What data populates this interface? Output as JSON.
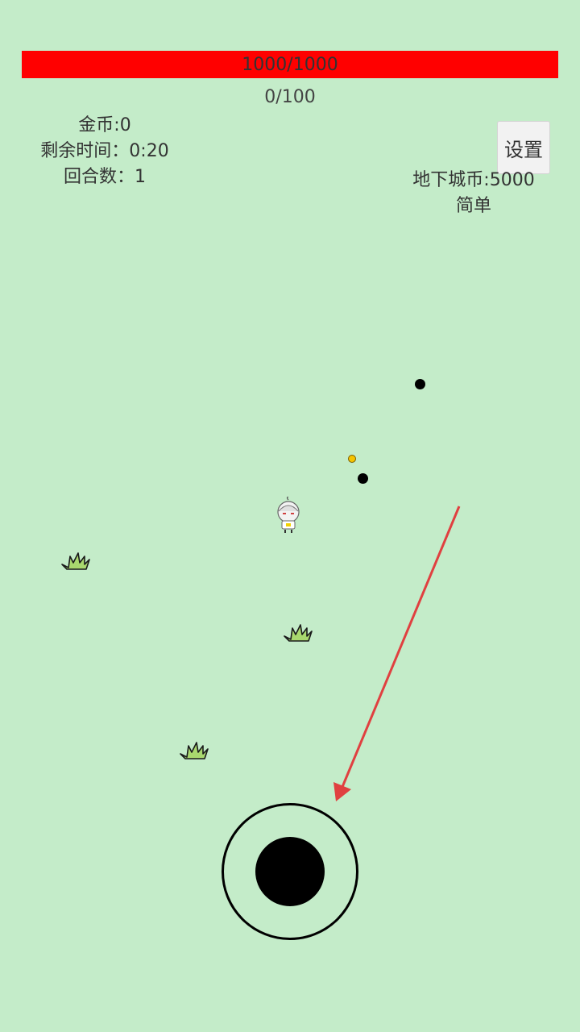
{
  "colors": {
    "background": "#c4ecc9",
    "hp_bar": "#ff0000",
    "enemy": "#000000",
    "coin": "#f5c400",
    "arrow": "#e04040",
    "grass_fill": "#a9d86e",
    "grass_outline": "#1a1a1a",
    "joystick": "#000000"
  },
  "hud": {
    "hp_text": "1000/1000",
    "hp_fraction": 1.0,
    "xp_text": "0/100",
    "gold": "金币:0",
    "time_left": "剩余时间：0:20",
    "round": "回合数：1",
    "settings_label": "设置",
    "dungeon_coins": "地下城币:5000",
    "difficulty": "简单"
  },
  "icons": {
    "player": "chibi-character-icon",
    "enemy": "black-dot-enemy",
    "coin": "gold-coin-icon",
    "grass": "grass-tuft-icon",
    "arrow": "direction-arrow"
  }
}
